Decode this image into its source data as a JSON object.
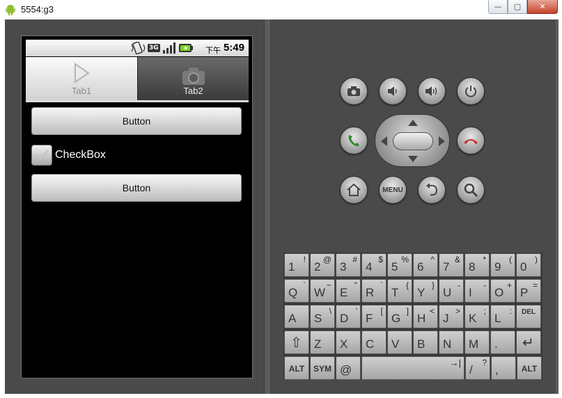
{
  "window": {
    "title": "5554:g3",
    "min_label": "—",
    "max_label": "▢",
    "close_label": "✕"
  },
  "statusbar": {
    "network": "3G",
    "ampm": "下午",
    "time": "5:49"
  },
  "tabs": [
    {
      "label": "Tab1",
      "selected": true,
      "icon": "play-icon"
    },
    {
      "label": "Tab2",
      "selected": false,
      "icon": "camera-icon"
    }
  ],
  "content": {
    "button1_label": "Button",
    "checkbox_label": "CheckBox",
    "checkbox_checked": true,
    "button2_label": "Button"
  },
  "controls": {
    "menu_label": "MENU"
  },
  "keyboard": {
    "rows": [
      [
        [
          "1",
          "!"
        ],
        [
          "2",
          "@"
        ],
        [
          "3",
          "#"
        ],
        [
          "4",
          "$"
        ],
        [
          "5",
          "%"
        ],
        [
          "6",
          "^"
        ],
        [
          "7",
          "&"
        ],
        [
          "8",
          "*"
        ],
        [
          "9",
          "("
        ],
        [
          "0",
          ")"
        ]
      ],
      [
        [
          "Q",
          "`"
        ],
        [
          "W",
          "~"
        ],
        [
          "E",
          "\""
        ],
        [
          "R",
          "`"
        ],
        [
          "T",
          "{"
        ],
        [
          "Y",
          "}"
        ],
        [
          "U",
          "-"
        ],
        [
          "I",
          "-"
        ],
        [
          "O",
          "+"
        ],
        [
          "P",
          "="
        ]
      ],
      [
        [
          "A",
          ""
        ],
        [
          "S",
          "\\"
        ],
        [
          "D",
          "'"
        ],
        [
          "F",
          "["
        ],
        [
          "G",
          "]"
        ],
        [
          "H",
          "<"
        ],
        [
          "J",
          ">"
        ],
        [
          "K",
          ";"
        ],
        [
          "L",
          ":"
        ],
        [
          "DEL",
          ""
        ]
      ],
      [
        [
          "⇧",
          ""
        ],
        [
          "Z",
          ""
        ],
        [
          "X",
          ""
        ],
        [
          "C",
          ""
        ],
        [
          "V",
          ""
        ],
        [
          "B",
          ""
        ],
        [
          "N",
          ""
        ],
        [
          "M",
          ""
        ],
        [
          ".",
          ""
        ],
        [
          "↵",
          ""
        ]
      ]
    ],
    "bottom": {
      "alt_left": "ALT",
      "sym": "SYM",
      "at": "@",
      "space_tab": "→|",
      "slash": "/",
      "slash_alt": "?",
      "comma": ",",
      "alt_right": "ALT"
    }
  }
}
